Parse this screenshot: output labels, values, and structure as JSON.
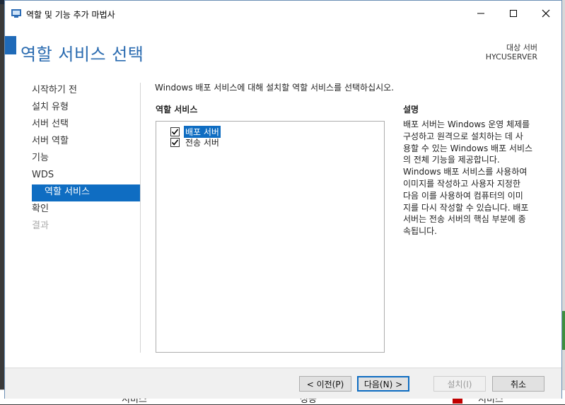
{
  "window": {
    "title": "역할 및 기능 추가 마법사",
    "minimize_glyph": "–",
    "maximize_glyph": "☐",
    "close_glyph": "✕"
  },
  "header": {
    "page_title": "역할 서비스 선택",
    "target_label": "대상 서버",
    "target_server": "HYCUSERVER"
  },
  "nav": {
    "items": [
      {
        "label": "시작하기 전",
        "state": "normal"
      },
      {
        "label": "설치 유형",
        "state": "normal"
      },
      {
        "label": "서버 선택",
        "state": "normal"
      },
      {
        "label": "서버 역할",
        "state": "normal"
      },
      {
        "label": "기능",
        "state": "normal"
      },
      {
        "label": "WDS",
        "state": "normal"
      },
      {
        "label": "역할 서비스",
        "state": "active"
      },
      {
        "label": "확인",
        "state": "normal"
      },
      {
        "label": "결과",
        "state": "disabled"
      }
    ]
  },
  "main": {
    "instruction": "Windows 배포 서비스에 대해 설치할 역할 서비스를 선택하십시오.",
    "roles_heading": "역할 서비스",
    "roles": [
      {
        "label": "배포 서버",
        "checked": true,
        "selected": true
      },
      {
        "label": "전송 서버",
        "checked": true,
        "selected": false
      }
    ],
    "description_heading": "설명",
    "description": "배포 서버는 Windows 운영 체제를\n구성하고 원격으로 설치하는 데 사\n용할 수 있는 Windows 배포 서비스\n의 전체 기능을 제공합니다.\nWindows 배포 서비스를 사용하여\n이미지를 작성하고 사용자 지정한\n다음 이를 사용하여 컴퓨터의 이미\n지를 다시 작성할 수 있습니다. 배포\n서버는 전송 서버의 핵심 부분에 종\n속됩니다."
  },
  "footer": {
    "prev_label": "< 이전(P)",
    "next_label": "다음(N) >",
    "install_label": "설치(I)",
    "cancel_label": "취소"
  },
  "background": {
    "bottom_texts": [
      "서비스",
      "성능",
      "서비스"
    ]
  },
  "colors": {
    "accent": "#0f6dc2",
    "title_blue": "#2a6bb0",
    "disabled_text": "#a8a8a8"
  }
}
